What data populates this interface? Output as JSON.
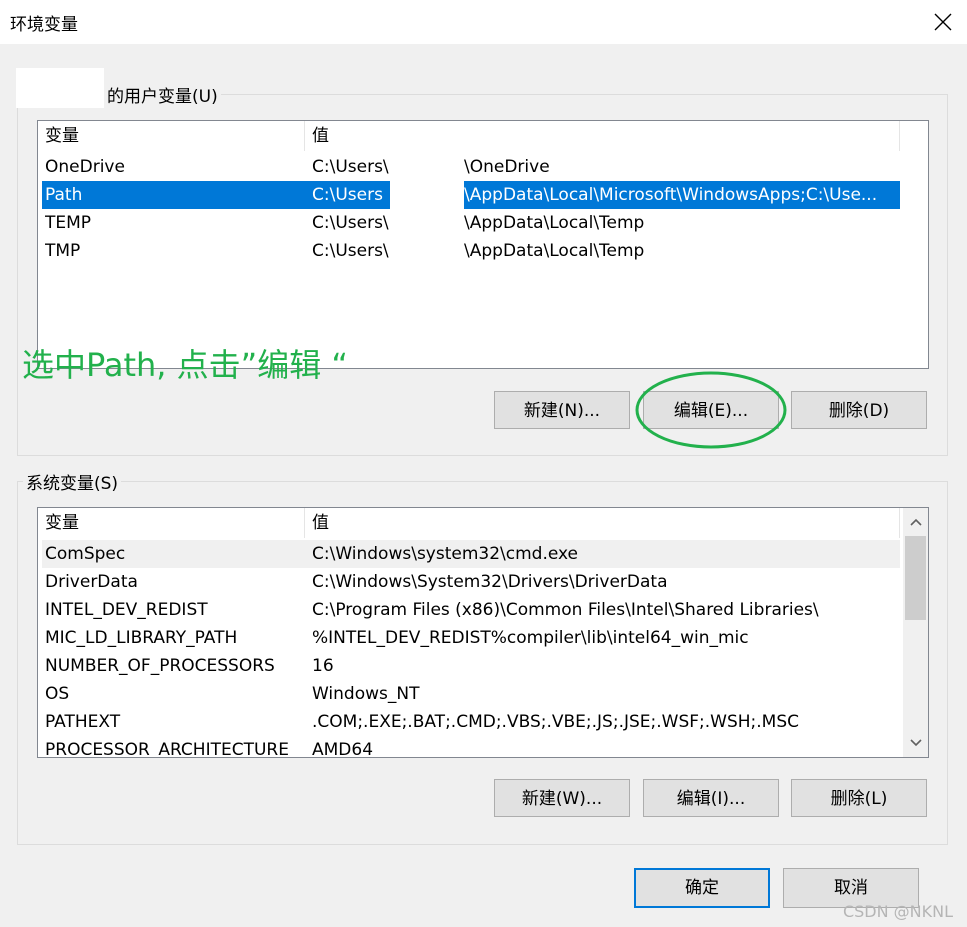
{
  "window": {
    "title": "环境变量"
  },
  "user_vars": {
    "group_label": "的用户变量(U)",
    "columns": [
      "变量",
      "值"
    ],
    "rows": [
      {
        "name": "OneDrive",
        "value_prefix": "C:\\Users\\",
        "value_suffix": "\\OneDrive"
      },
      {
        "name": "Path",
        "value_prefix": "C:\\Users",
        "value_suffix": "\\AppData\\Local\\Microsoft\\WindowsApps;C:\\Use..."
      },
      {
        "name": "TEMP",
        "value_prefix": "C:\\Users\\",
        "value_suffix": "\\AppData\\Local\\Temp"
      },
      {
        "name": "TMP",
        "value_prefix": "C:\\Users\\",
        "value_suffix": "\\AppData\\Local\\Temp"
      }
    ],
    "buttons": {
      "new": "新建(N)...",
      "edit": "编辑(E)...",
      "delete": "删除(D)"
    }
  },
  "annotation": {
    "text": "选中Path, 点击”编辑 “",
    "color": "#22b14c"
  },
  "system_vars": {
    "group_label": "系统变量(S)",
    "columns": [
      "变量",
      "值"
    ],
    "rows": [
      {
        "name": "ComSpec",
        "value": "C:\\Windows\\system32\\cmd.exe"
      },
      {
        "name": "DriverData",
        "value": "C:\\Windows\\System32\\Drivers\\DriverData"
      },
      {
        "name": "INTEL_DEV_REDIST",
        "value": "C:\\Program Files (x86)\\Common Files\\Intel\\Shared Libraries\\"
      },
      {
        "name": "MIC_LD_LIBRARY_PATH",
        "value": "%INTEL_DEV_REDIST%compiler\\lib\\intel64_win_mic"
      },
      {
        "name": "NUMBER_OF_PROCESSORS",
        "value": "16"
      },
      {
        "name": "OS",
        "value": "Windows_NT"
      },
      {
        "name": "PATHEXT",
        "value": ".COM;.EXE;.BAT;.CMD;.VBS;.VBE;.JS;.JSE;.WSF;.WSH;.MSC"
      },
      {
        "name": "PROCESSOR_ARCHITECTURE",
        "value": "AMD64"
      }
    ],
    "buttons": {
      "new": "新建(W)...",
      "edit": "编辑(I)...",
      "delete": "删除(L)"
    }
  },
  "footer": {
    "ok": "确定",
    "cancel": "取消"
  },
  "watermark": "CSDN @NKNL",
  "colors": {
    "selection": "#0078d7",
    "annotation": "#22b14c",
    "default_button_border": "#0078d7"
  },
  "icons": {
    "close": "close-icon",
    "scroll_up": "chevron-up-icon",
    "scroll_down": "chevron-down-icon"
  }
}
